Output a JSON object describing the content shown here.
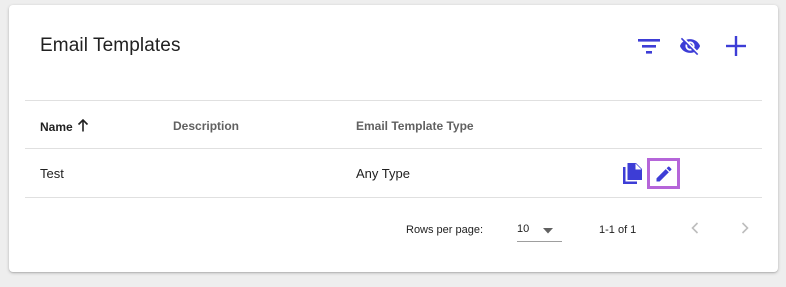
{
  "header": {
    "title": "Email Templates",
    "icons": [
      "filter-icon",
      "visibility-off-icon",
      "add-icon"
    ]
  },
  "table": {
    "columns": [
      {
        "label": "Name",
        "sort": "ascending",
        "sort_icon": "arrow-up-icon"
      },
      {
        "label": "Description"
      },
      {
        "label": "Email Template Type"
      }
    ],
    "rows": [
      {
        "name": "Test",
        "description": "",
        "type": "Any Type",
        "actions": [
          "copy-icon",
          "edit-icon"
        ]
      }
    ]
  },
  "pagination": {
    "rows_per_page_label": "Rows per page:",
    "rows_per_page_value": "10",
    "range": "1-1 of 1",
    "icons": [
      "chevron-left-icon",
      "chevron-right-icon"
    ]
  },
  "colors": {
    "accent": "#3d3dd6",
    "highlight_border": "#b565d9",
    "disabled": "#bdbdbd"
  }
}
